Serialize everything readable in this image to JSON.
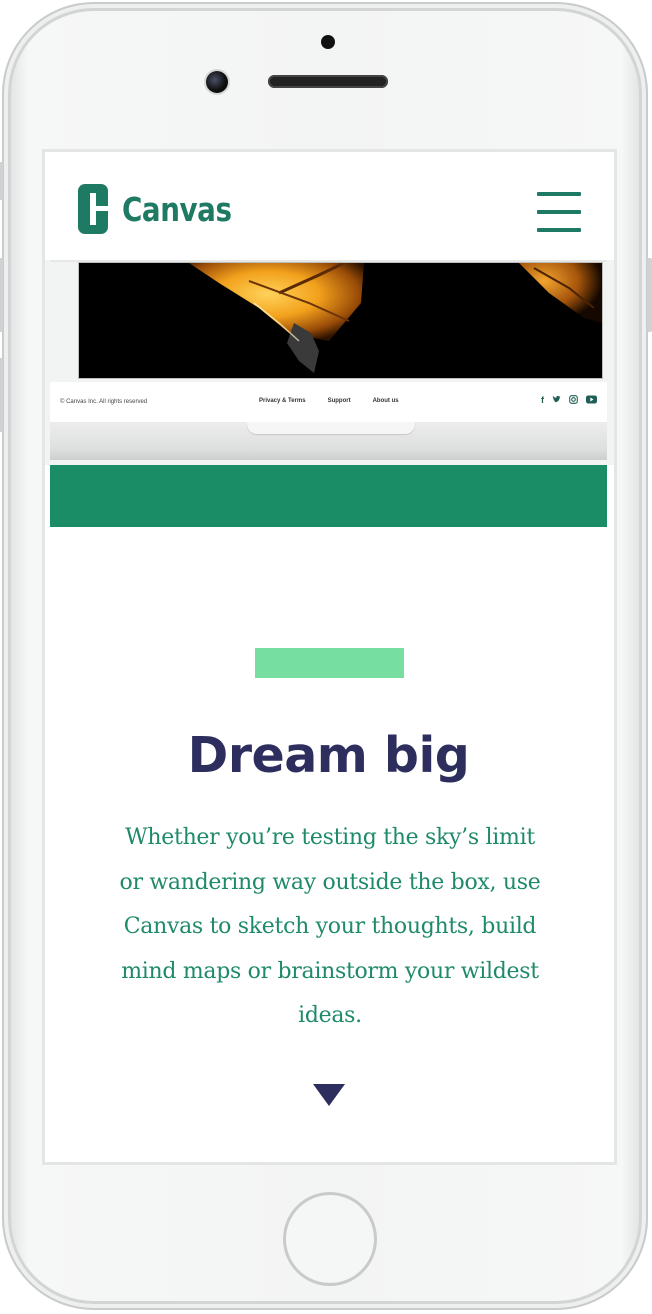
{
  "header": {
    "logo_text": "Canvas",
    "brand_color": "#1f7a63",
    "menu_icon": "hamburger-menu-icon"
  },
  "mockup_footer": {
    "copyright": "© Canvas Inc. All rights reserved",
    "links": [
      "Privacy & Terms",
      "Support",
      "About us"
    ],
    "social_icons": [
      "facebook-icon",
      "twitter-icon",
      "instagram-icon",
      "youtube-icon"
    ]
  },
  "hero": {
    "headline": "Dream big",
    "body": "Whether you’re testing the sky’s limit or wandering way outside the box, use Canvas to sketch your thoughts, build mind maps or brainstorm your wildest ideas.",
    "arrow_icon": "down-triangle-icon"
  },
  "colors": {
    "green_band": "#1a8c66",
    "accent_bar": "#76dea1",
    "headline": "#2d2d5e",
    "body_text": "#1f8a6a"
  }
}
